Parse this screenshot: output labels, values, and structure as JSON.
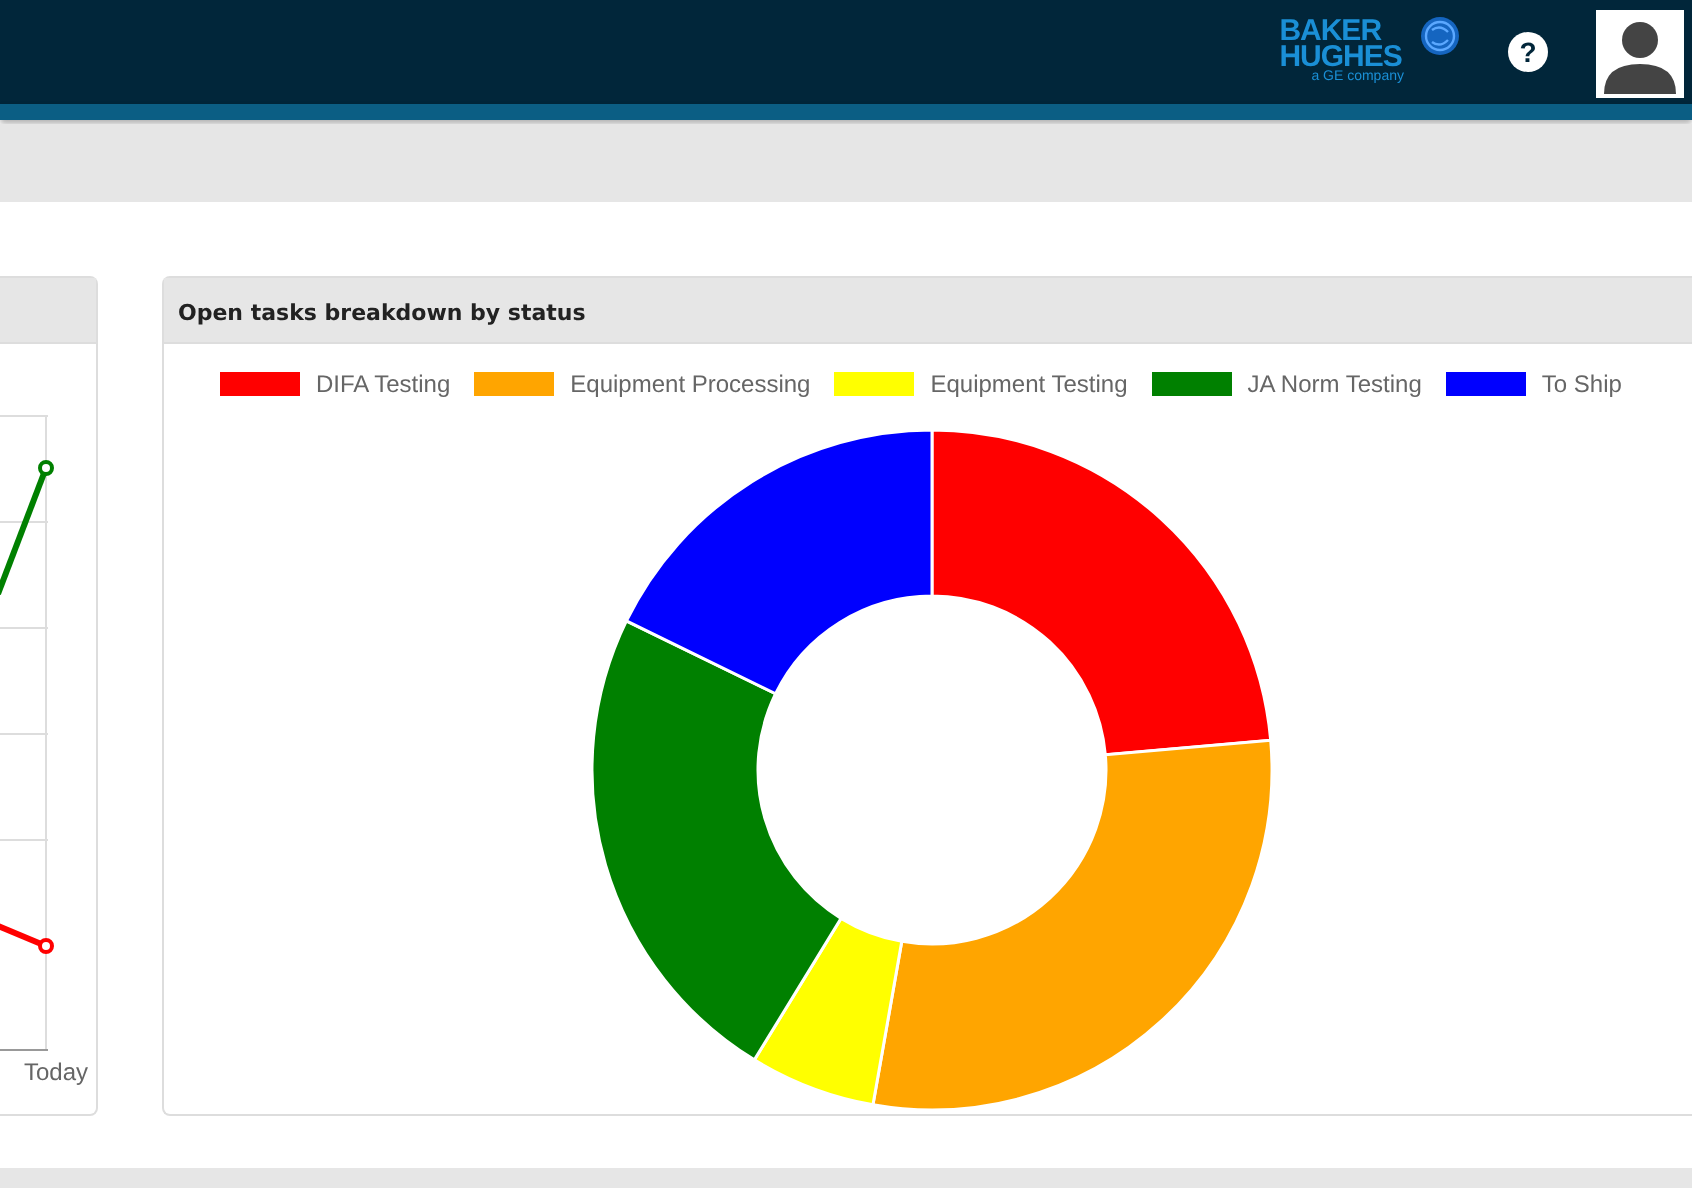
{
  "header": {
    "logo": {
      "line_1": "BAKER",
      "line_2": "HUGHES",
      "tagline": "a GE company"
    },
    "help_button": "?"
  },
  "left_card": {
    "x_label": "Today"
  },
  "right_card": {
    "title": "Open tasks breakdown by status",
    "legend": [
      {
        "label": "DIFA Testing",
        "color": "#ff0000"
      },
      {
        "label": "Equipment Processing",
        "color": "#ffa500"
      },
      {
        "label": "Equipment Testing",
        "color": "#ffff00"
      },
      {
        "label": "JA Norm Testing",
        "color": "#008000"
      },
      {
        "label": "To Ship",
        "color": "#0000ff"
      }
    ]
  }
}
